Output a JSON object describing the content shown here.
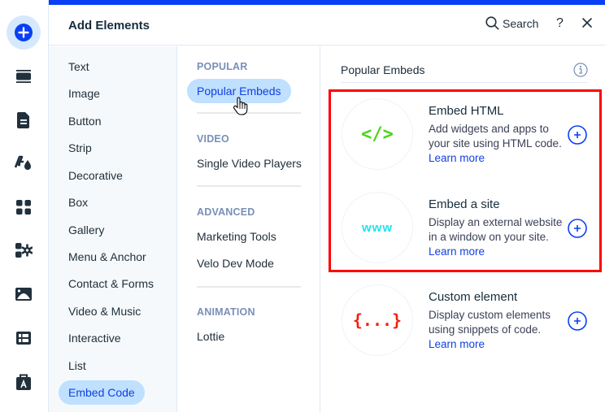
{
  "panel": {
    "title": "Add Elements",
    "search_label": "Search",
    "help_label": "?",
    "accent_color": "#0a3ff5"
  },
  "rail": {
    "items": [
      {
        "icon": "add-icon",
        "active": true
      },
      {
        "icon": "strip-layout-icon"
      },
      {
        "icon": "page-icon"
      },
      {
        "icon": "theme-design-icon"
      },
      {
        "icon": "apps-grid-icon"
      },
      {
        "icon": "app-market-icon"
      },
      {
        "icon": "media-image-icon"
      },
      {
        "icon": "cms-table-icon"
      },
      {
        "icon": "portfolio-briefcase-icon"
      }
    ]
  },
  "categories": [
    {
      "label": "Text"
    },
    {
      "label": "Image"
    },
    {
      "label": "Button"
    },
    {
      "label": "Strip"
    },
    {
      "label": "Decorative"
    },
    {
      "label": "Box"
    },
    {
      "label": "Gallery"
    },
    {
      "label": "Menu & Anchor"
    },
    {
      "label": "Contact & Forms"
    },
    {
      "label": "Video & Music"
    },
    {
      "label": "Interactive"
    },
    {
      "label": "List"
    },
    {
      "label": "Embed Code",
      "active": true
    }
  ],
  "subcategories": {
    "popular": {
      "title": "POPULAR",
      "items": [
        "Popular Embeds"
      ]
    },
    "video": {
      "title": "VIDEO",
      "items": [
        "Single Video Players"
      ]
    },
    "advanced": {
      "title": "ADVANCED",
      "items": [
        "Marketing Tools",
        "Velo Dev Mode"
      ]
    },
    "animation": {
      "title": "ANIMATION",
      "items": [
        "Lottie"
      ]
    }
  },
  "content": {
    "title": "Popular Embeds",
    "cards": [
      {
        "name": "Embed HTML",
        "description": "Add widgets and apps to your site using HTML code.",
        "learn_more": "Learn more",
        "icon_text": "</>",
        "icon_color": "#46d614"
      },
      {
        "name": "Embed a site",
        "description": "Display an external website in a window on your site.",
        "learn_more": "Learn more",
        "icon_text": "www",
        "icon_color": "#1ee3ef"
      },
      {
        "name": "Custom element",
        "description": "Display custom elements using snippets of code.",
        "learn_more": "Learn more",
        "icon_text": "{...}",
        "icon_color": "#f31f0e"
      }
    ]
  },
  "annotation": {
    "highlight_color": "#ff0000"
  }
}
